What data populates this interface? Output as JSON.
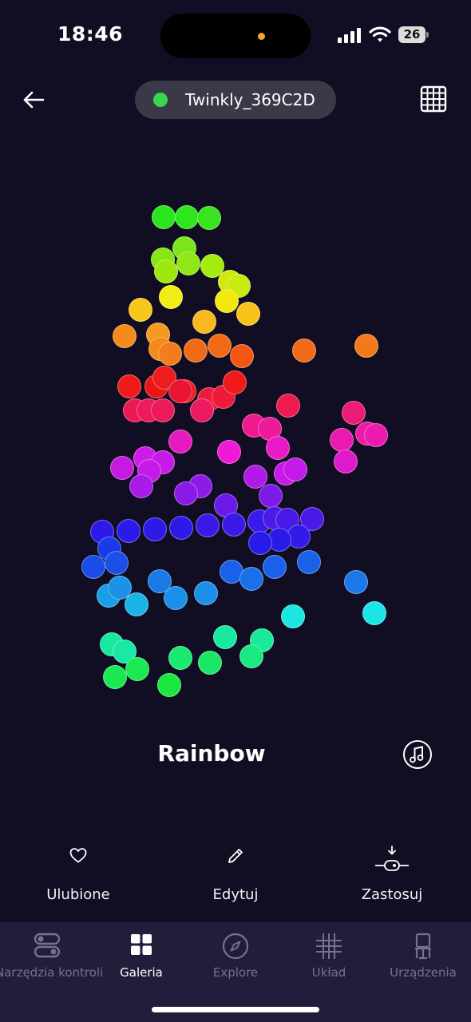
{
  "status": {
    "time": "18:46",
    "battery": "26"
  },
  "header": {
    "device_name": "Twinkly_369C2D",
    "connected_color": "#34d74f"
  },
  "effect": {
    "name": "Rainbow"
  },
  "actions": [
    {
      "label": "Ulubione",
      "icon": "heart-icon"
    },
    {
      "label": "Edytuj",
      "icon": "pencil-icon"
    },
    {
      "label": "Zastosuj",
      "icon": "apply-download-icon"
    }
  ],
  "tabs": [
    {
      "label": "Narzędzia kontroli",
      "icon": "toggles-icon",
      "active": false
    },
    {
      "label": "Galeria",
      "icon": "gallery-grid-icon",
      "active": true
    },
    {
      "label": "Explore",
      "icon": "compass-icon",
      "active": false
    },
    {
      "label": "Układ",
      "icon": "layout-grid-icon",
      "active": false
    },
    {
      "label": "Urządzenia",
      "icon": "devices-icon",
      "active": false
    }
  ],
  "colors": {
    "background": "#110d22",
    "tabbar": "#231c3b",
    "pill": "#3b3948",
    "inactive_tab": "#77718d"
  }
}
